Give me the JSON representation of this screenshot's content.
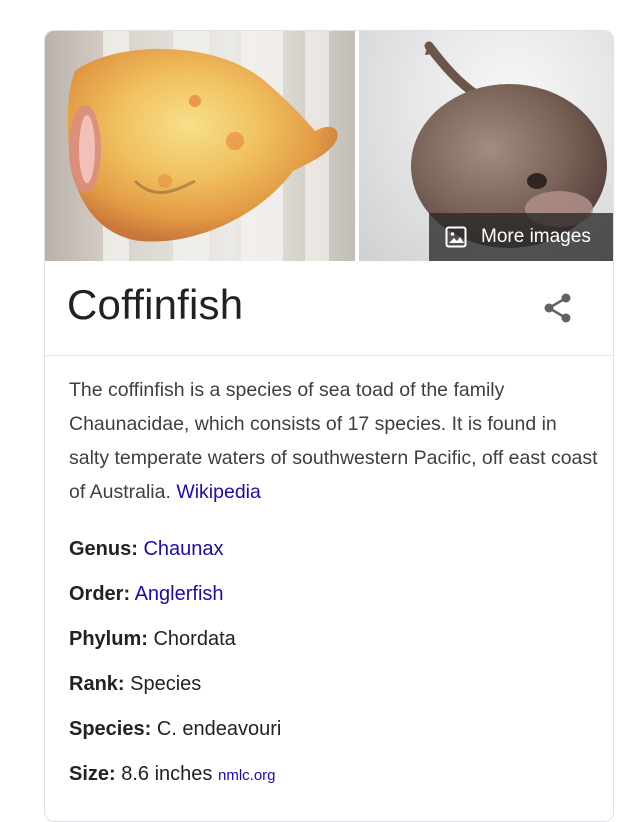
{
  "card": {
    "more_images_label": "More images",
    "title": "Coffinfish",
    "description": "The coffinfish is a species of sea toad of the family Chaunacidae, which consists of 17 species. It is found in salty temperate waters of southwestern Pacific, off east coast of Australia.",
    "description_source": "Wikipedia",
    "facts": {
      "genus": {
        "label": "Genus:",
        "value": "Chaunax"
      },
      "order": {
        "label": "Order:",
        "value": "Anglerfish"
      },
      "phylum": {
        "label": "Phylum:",
        "value": "Chordata"
      },
      "rank": {
        "label": "Rank:",
        "value": "Species"
      },
      "species": {
        "label": "Species:",
        "value": "C. endeavouri"
      },
      "size": {
        "label": "Size:",
        "value": "8.6 inches",
        "source": "nmlc.org"
      }
    }
  },
  "colors": {
    "link": "#1a0dab",
    "text": "#222222",
    "divider": "#e4e4e4"
  },
  "icons": {
    "more_images": "image-icon",
    "share": "share-icon"
  }
}
